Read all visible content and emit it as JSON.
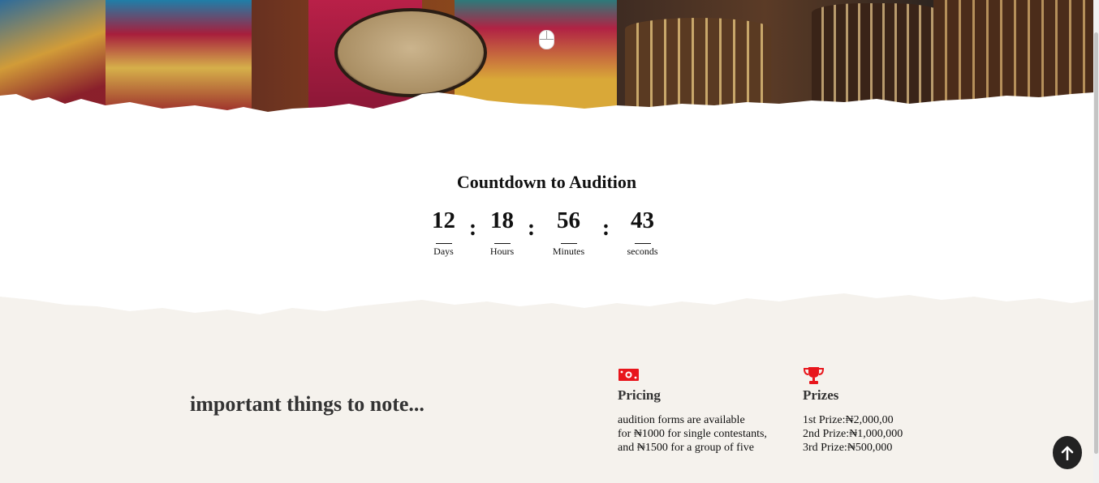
{
  "hero": {
    "scroll_icon": "mouse-icon"
  },
  "countdown": {
    "title": "Countdown to Audition",
    "units": [
      {
        "value": "12",
        "label": "Days"
      },
      {
        "value": "18",
        "label": "Hours"
      },
      {
        "value": "56",
        "label": "Minutes"
      },
      {
        "value": "43",
        "label": "seconds"
      }
    ],
    "separator": ":"
  },
  "notes": {
    "title": "important things to note...",
    "pricing": {
      "icon": "money-bill-icon",
      "heading": "Pricing",
      "lines": [
        "audition forms are available",
        "for ₦1000 for single contestants,",
        "and ₦1500 for a group of five"
      ]
    },
    "prizes": {
      "icon": "trophy-icon",
      "heading": "Prizes",
      "lines": [
        "1st Prize:₦2,000,00",
        "2nd Prize:₦1,000,000",
        "3rd Prize:₦500,000"
      ]
    }
  },
  "colors": {
    "accent": "#e8161c",
    "section_bg": "#f5f2ed",
    "back_to_top_bg": "#222222"
  },
  "back_to_top": {
    "icon": "arrow-up-icon"
  }
}
